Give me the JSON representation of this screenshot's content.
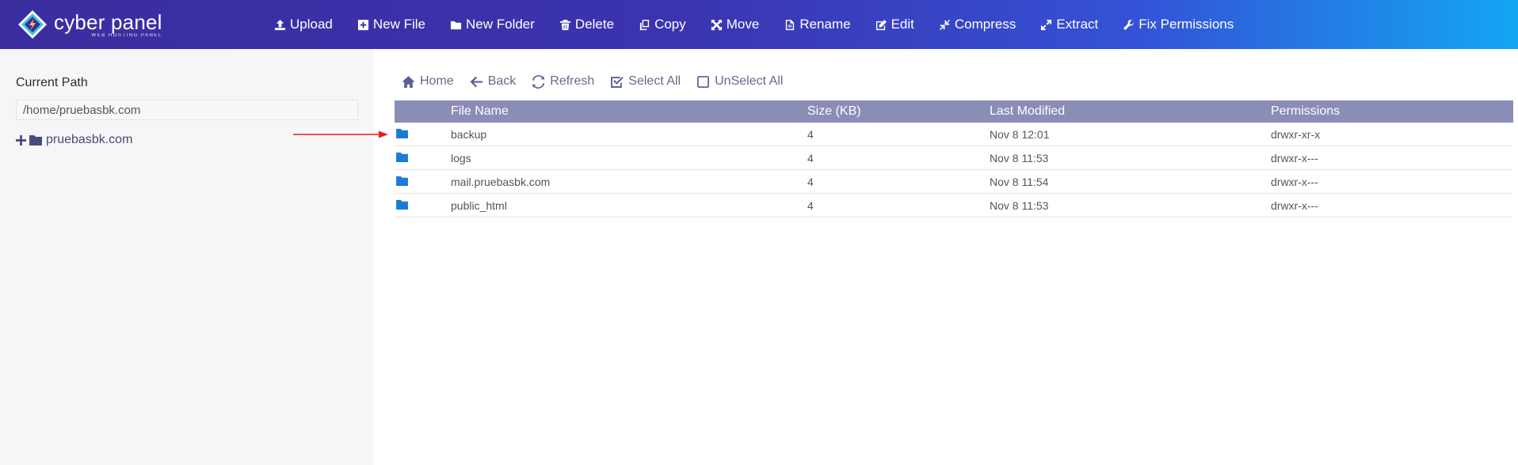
{
  "brand": {
    "title": "cyber panel",
    "subtitle": "WEB HOSTING PANEL"
  },
  "toolbar": [
    {
      "label": "Upload",
      "icon": "upload-icon"
    },
    {
      "label": "New File",
      "icon": "plus-square-icon"
    },
    {
      "label": "New Folder",
      "icon": "folder-icon"
    },
    {
      "label": "Delete",
      "icon": "trash-icon"
    },
    {
      "label": "Copy",
      "icon": "copy-icon"
    },
    {
      "label": "Move",
      "icon": "move-icon"
    },
    {
      "label": "Rename",
      "icon": "file-icon"
    },
    {
      "label": "Edit",
      "icon": "edit-icon"
    },
    {
      "label": "Compress",
      "icon": "compress-icon"
    },
    {
      "label": "Extract",
      "icon": "expand-icon"
    },
    {
      "label": "Fix Permissions",
      "icon": "wrench-icon"
    }
  ],
  "sidebar": {
    "current_path_label": "Current Path",
    "current_path_value": "/home/pruebasbk.com",
    "tree_root": "pruebasbk.com"
  },
  "nav": {
    "home": "Home",
    "back": "Back",
    "refresh": "Refresh",
    "select_all": "Select All",
    "unselect_all": "UnSelect All"
  },
  "table": {
    "headers": {
      "name": "File Name",
      "size": "Size (KB)",
      "modified": "Last Modified",
      "permissions": "Permissions"
    },
    "rows": [
      {
        "name": "backup",
        "size": "4",
        "modified": "Nov 8 12:01",
        "permissions": "drwxr-xr-x"
      },
      {
        "name": "logs",
        "size": "4",
        "modified": "Nov 8 11:53",
        "permissions": "drwxr-x---"
      },
      {
        "name": "mail.pruebasbk.com",
        "size": "4",
        "modified": "Nov 8 11:54",
        "permissions": "drwxr-x---"
      },
      {
        "name": "public_html",
        "size": "4",
        "modified": "Nov 8 11:53",
        "permissions": "drwxr-x---"
      }
    ]
  },
  "colors": {
    "header_gradient_start": "#3a2d9e",
    "header_gradient_end": "#13a6f3",
    "table_header": "#8a8db5",
    "folder": "#1b7bd8",
    "annotation_arrow": "#e02020"
  }
}
